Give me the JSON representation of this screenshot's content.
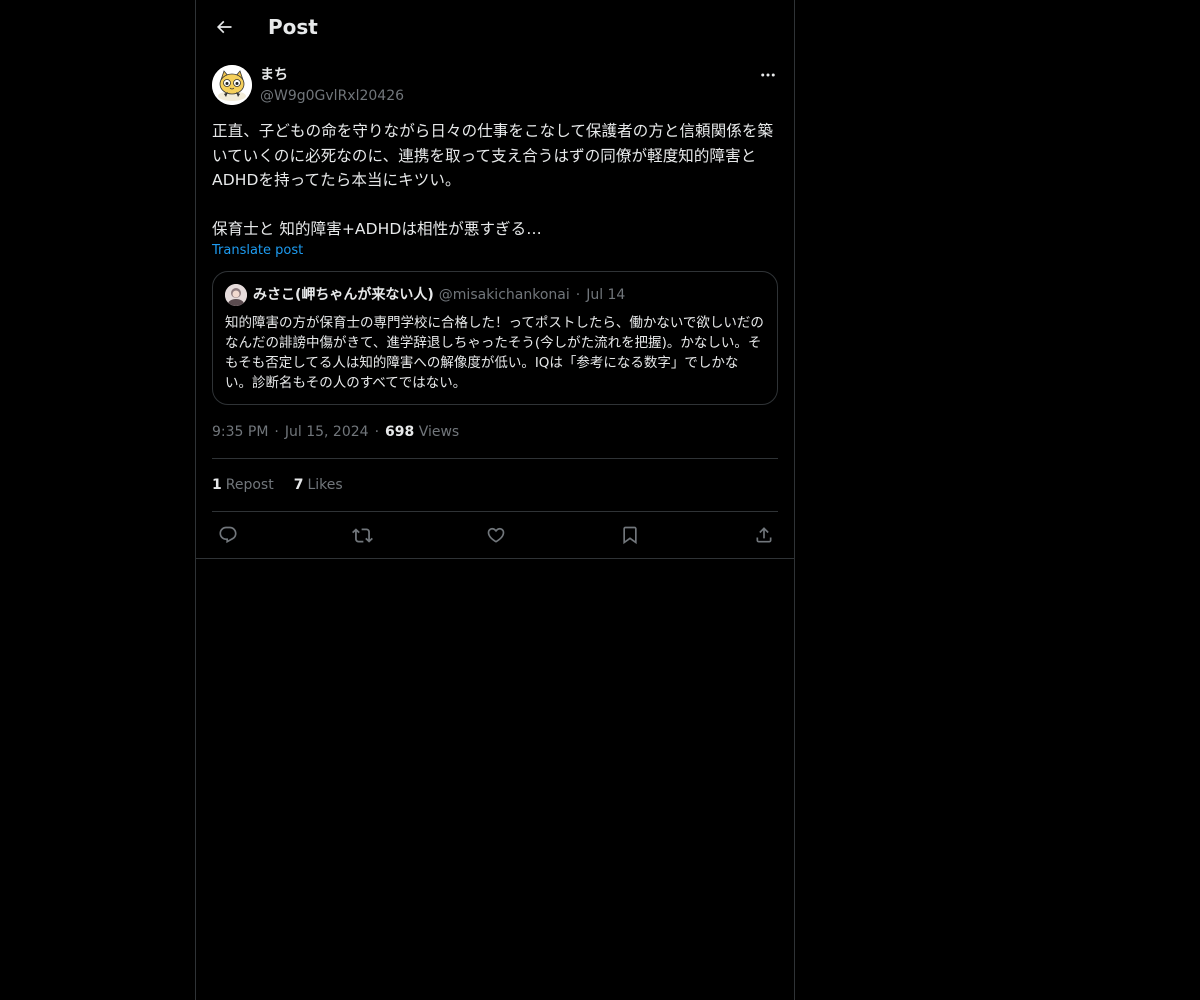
{
  "header": {
    "title": "Post",
    "back_icon": "arrow-left-icon"
  },
  "post": {
    "author": {
      "name": "まち",
      "handle": "@W9g0GvlRxl20426"
    },
    "text": "正直、子どもの命を守りながら日々の仕事をこなして保護者の方と信頼関係を築いていくのに必死なのに、連携を取って支え合うはずの同僚が軽度知的障害とADHDを持ってたら本当にキツい。\n\n保育士と 知的障害+ADHDは相性が悪すぎる…",
    "translate_label": "Translate post",
    "time": "9:35 PM",
    "date": "Jul 15, 2024",
    "views_count": "698",
    "views_label": "Views",
    "reposts_count": "1",
    "reposts_label": "Repost",
    "likes_count": "7",
    "likes_label": "Likes"
  },
  "quote": {
    "name": "みさこ(岬ちゃんが来ない人)",
    "handle": "@misakichankonai",
    "separator": "·",
    "date": "Jul 14",
    "text": "知的障害の方が保育士の専門学校に合格した！ってポストしたら、働かないで欲しいだのなんだの誹謗中傷がきて、進学辞退しちゃったそう(今しがた流れを把握)。かなしい。そもそも否定してる人は知的障害への解像度が低い。IQは「参考になる数字」でしかない。診断名もその人のすべてではない。"
  },
  "meta_separator": "·",
  "actions": [
    "reply-icon",
    "repost-icon",
    "like-icon",
    "bookmark-icon",
    "share-icon"
  ],
  "colors": {
    "background": "#000000",
    "text": "#e7e9ea",
    "muted": "#71767b",
    "border": "#2f3336",
    "link": "#1d9bf0"
  }
}
